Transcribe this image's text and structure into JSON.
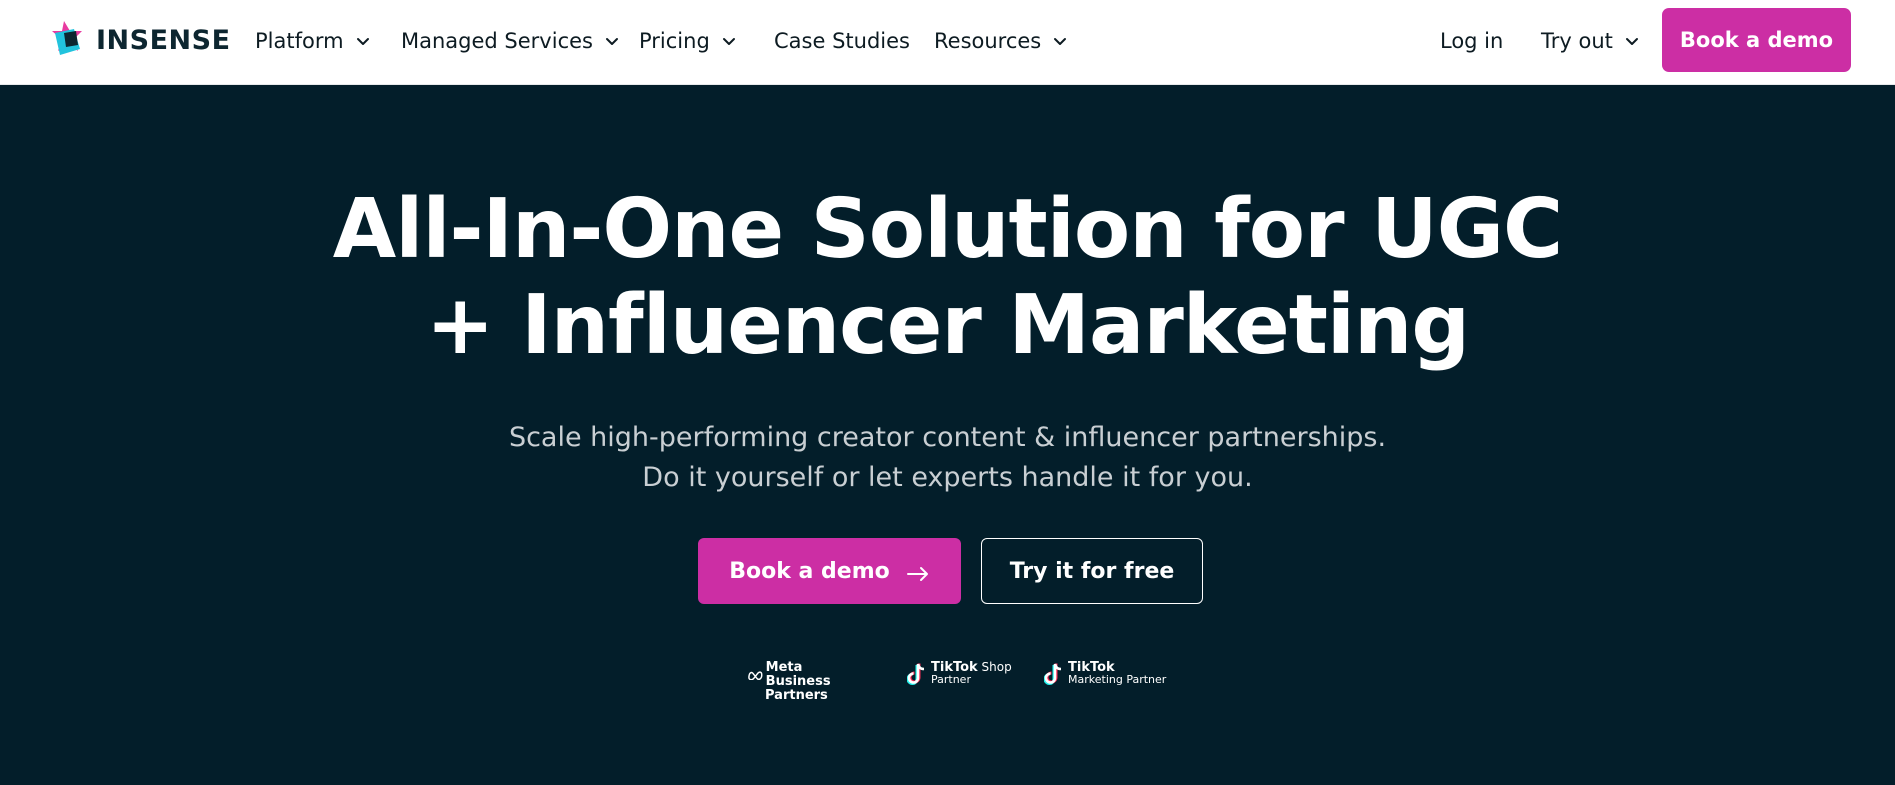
{
  "brand": {
    "name": "INSENSE",
    "colors": {
      "pink": "#cc2ea4",
      "teal": "#22c3dd",
      "dark": "#031e2a"
    }
  },
  "nav": {
    "items": [
      {
        "label": "Platform",
        "has_dropdown": true
      },
      {
        "label": "Managed Services",
        "has_dropdown": true
      },
      {
        "label": "Pricing",
        "has_dropdown": true
      },
      {
        "label": "Case Studies",
        "has_dropdown": false
      },
      {
        "label": "Resources",
        "has_dropdown": true
      }
    ],
    "login": "Log in",
    "try_out": "Try out",
    "cta": "Book a demo"
  },
  "hero": {
    "headline_line1": "All-In-One Solution for UGC",
    "headline_line2": "+ Influencer Marketing",
    "subtitle_line1": "Scale high-performing creator content & influencer partnerships.",
    "subtitle_line2": "Do it yourself or let experts handle it for you.",
    "primary_cta": "Book a demo",
    "secondary_cta": "Try it for free"
  },
  "partners": {
    "meta": {
      "line1": "Meta Business",
      "line2": "Partners"
    },
    "tiktok_shop": {
      "brand": "TikTok",
      "line1_suffix": "Shop",
      "line2": "Partner"
    },
    "tiktok_marketing": {
      "brand": "TikTok",
      "line2": "Marketing Partner"
    }
  }
}
